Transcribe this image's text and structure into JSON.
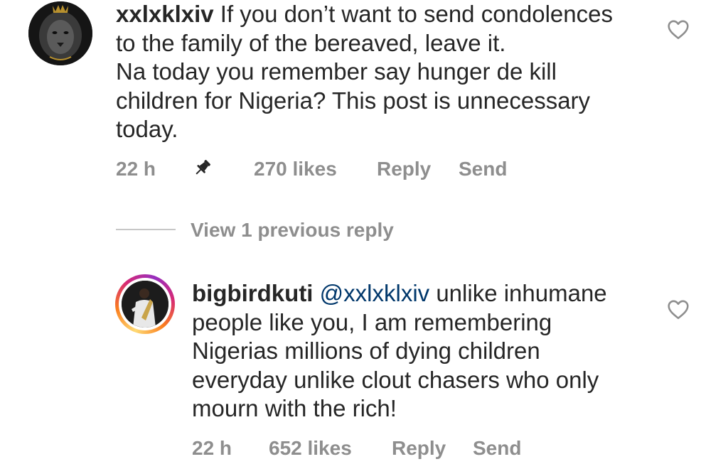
{
  "comment1": {
    "username": "xxlxklxiv",
    "text": " If you don’t want to send condolences\nto the family of the bereaved, leave it.\nNa today you remember say hunger de kill\nchildren for Nigeria? This post is unnecessary\ntoday.",
    "time": "22 h",
    "likes": "270 likes",
    "reply": "Reply",
    "send": "Send",
    "pinned": true
  },
  "replies_toggle": {
    "label": "View 1 previous reply"
  },
  "comment2": {
    "username": "bigbirdkuti",
    "mention": "@xxlxklxiv",
    "text": " unlike inhumane\npeople like you, I am remembering\nNigerias millions of dying children\neveryday unlike clout chasers who only\nmourn with the rich!",
    "time": "22 h",
    "likes": "652 likes",
    "reply": "Reply",
    "send": "Send"
  },
  "colors": {
    "text": "#262626",
    "meta": "#8e8e8e",
    "mention": "#00376b",
    "divider": "#c7c7c7"
  }
}
